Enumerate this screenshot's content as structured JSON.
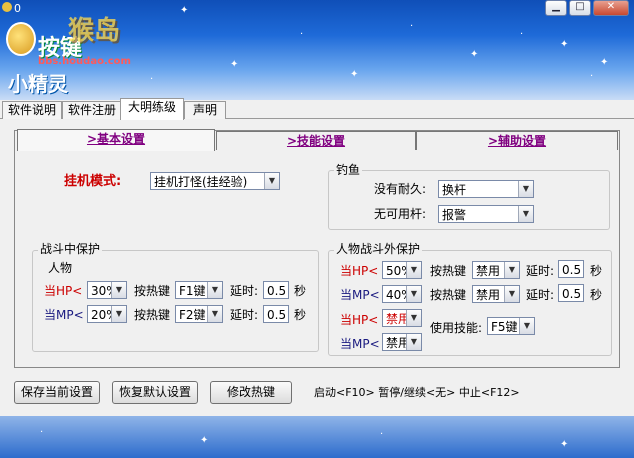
{
  "window": {
    "title_text": "0",
    "min_icon": "minimize-icon",
    "max_icon": "maximize-icon",
    "close_icon": "close-icon"
  },
  "logo": {
    "line1": "按键",
    "line2": "小精灵",
    "watermark": "bbs.houdao.com",
    "site_mark": "猴岛"
  },
  "tabs": [
    {
      "label": "软件说明"
    },
    {
      "label": "软件注册"
    },
    {
      "label": "大明练级"
    },
    {
      "label": "声明"
    }
  ],
  "subtabs": [
    {
      "label": ">基本设置"
    },
    {
      "label": ">技能设置"
    },
    {
      "label": ">辅助设置"
    }
  ],
  "hang": {
    "label": "挂机模式:",
    "value": "挂机打怪(挂经验)"
  },
  "fishing": {
    "title": "钓鱼",
    "no_durability_label": "没有耐久:",
    "no_durability_value": "换杆",
    "no_rod_label": "无可用杆:",
    "no_rod_value": "报警"
  },
  "battle": {
    "title": "战斗中保护",
    "subtitle": "人物",
    "hp_label": "当HP<",
    "hp_value": "30%",
    "hp_hotkey_label": "按热键",
    "hp_hotkey": "F1键",
    "hp_delay_label": "延时:",
    "hp_delay": "0.5",
    "hp_unit": "秒",
    "mp_label": "当MP<",
    "mp_value": "20%",
    "mp_hotkey_label": "按热键",
    "mp_hotkey": "F2键",
    "mp_delay_label": "延时:",
    "mp_delay": "0.5",
    "mp_unit": "秒"
  },
  "outside": {
    "title": "人物战斗外保护",
    "hp_label": "当HP<",
    "hp_value": "50%",
    "hp_hotkey_label": "按热键",
    "hp_hotkey": "禁用",
    "hp_delay_label": "延时:",
    "hp_delay": "0.5",
    "hp_unit": "秒",
    "mp_label": "当MP<",
    "mp_value": "40%",
    "mp_hotkey_label": "按热键",
    "mp_hotkey": "禁用",
    "mp_delay_label": "延时:",
    "mp_delay": "0.5",
    "mp_unit": "秒",
    "hp2_label": "当HP<",
    "hp2_value": "禁用",
    "mp2_label": "当MP<",
    "mp2_value": "禁用",
    "skill_label": "使用技能:",
    "skill_value": "F5键"
  },
  "buttons": {
    "save": "保存当前设置",
    "restore": "恢复默认设置",
    "hotkey": "修改热键"
  },
  "hotkey_status": "启动<F10> 暂停/继续<无> 中止<F12>",
  "colors": {
    "accent_red": "#cc0000",
    "subtab_purple": "#800080",
    "banner_blue": "#1e6ad8"
  }
}
